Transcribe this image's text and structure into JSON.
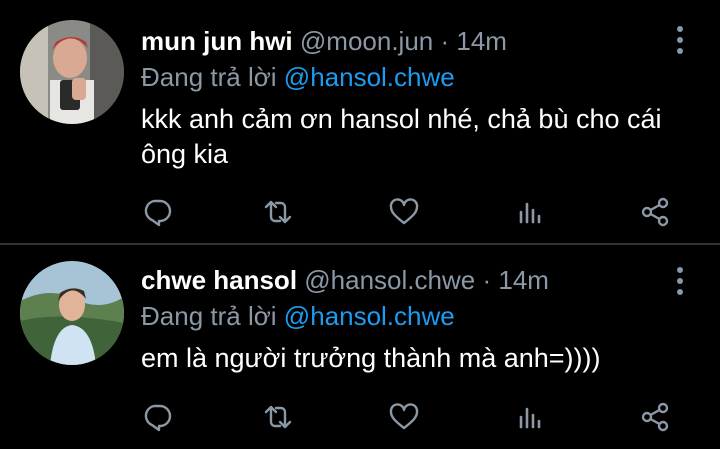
{
  "tweets": [
    {
      "display_name": "mun jun hwi",
      "handle": "@moon.jun",
      "separator": "·",
      "time": "14m",
      "reply_prefix": "Đang trả lời",
      "reply_to": "@hansol.chwe",
      "text": "kkk anh cảm ơn hansol nhé, chả bù cho cái ông kia",
      "avatar": "avatar-photo"
    },
    {
      "display_name": "chwe hansol",
      "handle": "@hansol.chwe",
      "separator": "·",
      "time": "14m",
      "reply_prefix": "Đang trả lời",
      "reply_to": "@hansol.chwe",
      "text": "em là người trưởng thành mà anh=))))",
      "avatar": "avatar-photo"
    }
  ],
  "icons": {
    "more": "more-vertical-icon",
    "reply": "reply-icon",
    "retweet": "retweet-icon",
    "like": "heart-icon",
    "stats": "stats-icon",
    "share": "share-icon"
  },
  "colors": {
    "background": "#000000",
    "text": "#ffffff",
    "muted": "#8b98a5",
    "link": "#1d9bf0",
    "divider": "#2f3336"
  }
}
